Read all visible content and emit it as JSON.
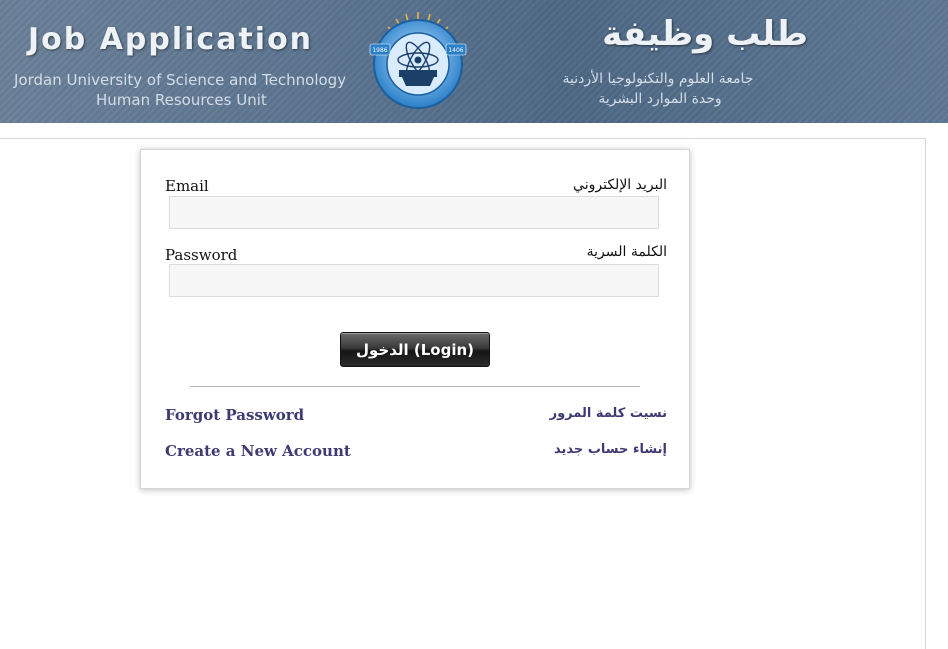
{
  "header": {
    "title": "Job Application",
    "subtitle_line1": "Jordan University of Science and Technology",
    "subtitle_line2": "Human Resources Unit",
    "title_ar": "طلب وظيفة",
    "subtitle_ar_line1": "جامعة العلوم والتكنولوجيا الأردنية",
    "subtitle_ar_line2": "وحدة الموارد البشرية",
    "logo_year_left": "1986",
    "logo_year_right": "1406"
  },
  "form": {
    "email_label": "Email",
    "email_label_ar": "البريد الإلكتروني",
    "email_value": "",
    "password_label": "Password",
    "password_label_ar": "الكلمة السرية",
    "password_value": "",
    "login_button": "الدخول (Login)"
  },
  "links": {
    "forgot_password": "Forgot Password",
    "forgot_password_ar": "نسيت كلمة المرور",
    "create_account": "Create a New Account",
    "create_account_ar": "إنشاء حساب جديد"
  },
  "colors": {
    "header_bg": "#56708d",
    "link": "#3d3a74",
    "button_bg": "#2c2c2c"
  }
}
